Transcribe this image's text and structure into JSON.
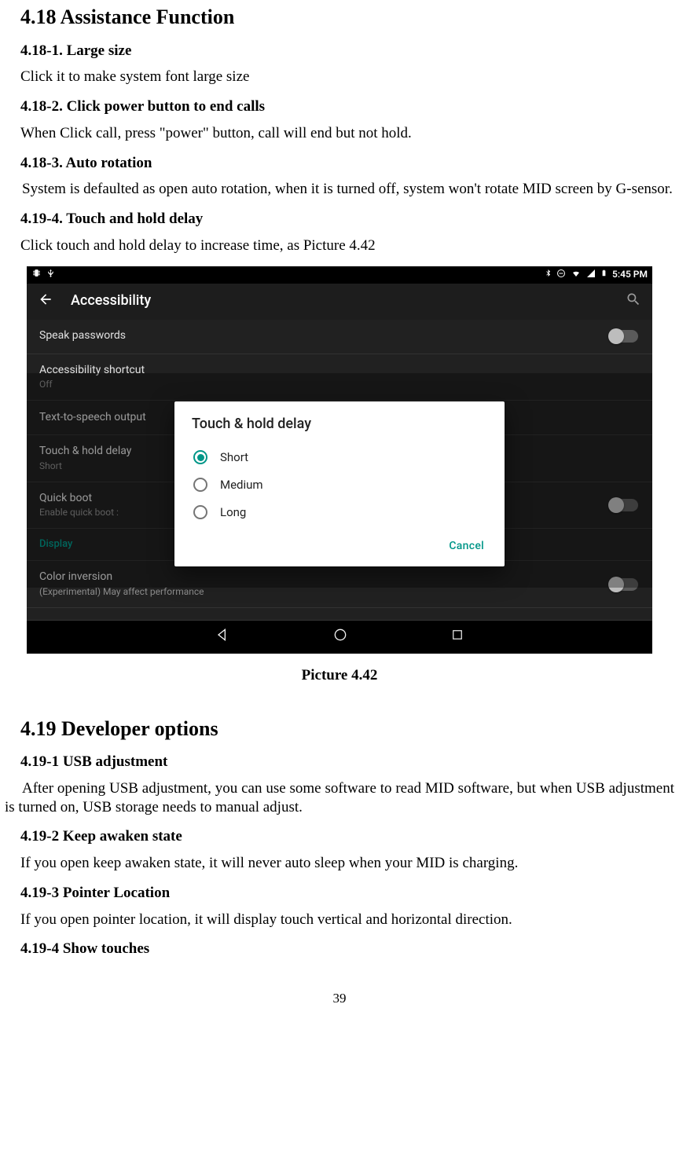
{
  "section418": {
    "heading": "4.18 Assistance Function",
    "items": [
      {
        "head": "4.18-1. Large size",
        "body": "Click it to make system font large size"
      },
      {
        "head": "4.18-2. Click power button to end calls",
        "body": "When Click call, press \"power\" button, call will end but not hold."
      },
      {
        "head": "4.18-3. Auto rotation",
        "body": "System is defaulted as open auto rotation, when it is turned off, system won't rotate MID screen by G-sensor."
      },
      {
        "head": "4.19-4. Touch and hold delay",
        "body": "Click touch and hold delay to increase time, as Picture 4.42"
      }
    ]
  },
  "screenshot": {
    "statusbar": {
      "time": "5:45 PM"
    },
    "appbar": {
      "title": "Accessibility"
    },
    "rows": [
      {
        "primary": "Speak passwords",
        "secondary": "",
        "toggle": true
      },
      {
        "primary": "Accessibility shortcut",
        "secondary": "Off",
        "toggle": false
      },
      {
        "primary": "Text-to-speech output",
        "secondary": "",
        "toggle": false
      },
      {
        "primary": "Touch & hold delay",
        "secondary": "Short",
        "toggle": false
      },
      {
        "primary": "Quick boot",
        "secondary": "Enable quick boot :",
        "toggle": true
      },
      {
        "cat": "Display"
      },
      {
        "primary": "Color inversion",
        "secondary": "(Experimental) May affect performance",
        "toggle": true
      }
    ],
    "dialog": {
      "title": "Touch & hold delay",
      "options": [
        "Short",
        "Medium",
        "Long"
      ],
      "selected": 0,
      "cancel": "Cancel"
    }
  },
  "caption": "Picture 4.42",
  "section419": {
    "heading": "4.19 Developer options",
    "items": [
      {
        "head": "4.19-1 USB adjustment",
        "body": "After opening USB adjustment, you can use some software to read MID software, but when USB adjustment is turned on, USB storage needs to manual adjust."
      },
      {
        "head": "4.19-2 Keep awaken state",
        "body": "If you open keep awaken state, it will never auto sleep when your MID is charging."
      },
      {
        "head": "4.19-3 Pointer Location",
        "body": "If you open pointer location, it will display touch vertical and horizontal direction."
      },
      {
        "head": "4.19-4 Show touches",
        "body": ""
      }
    ]
  },
  "pageNumber": "39"
}
